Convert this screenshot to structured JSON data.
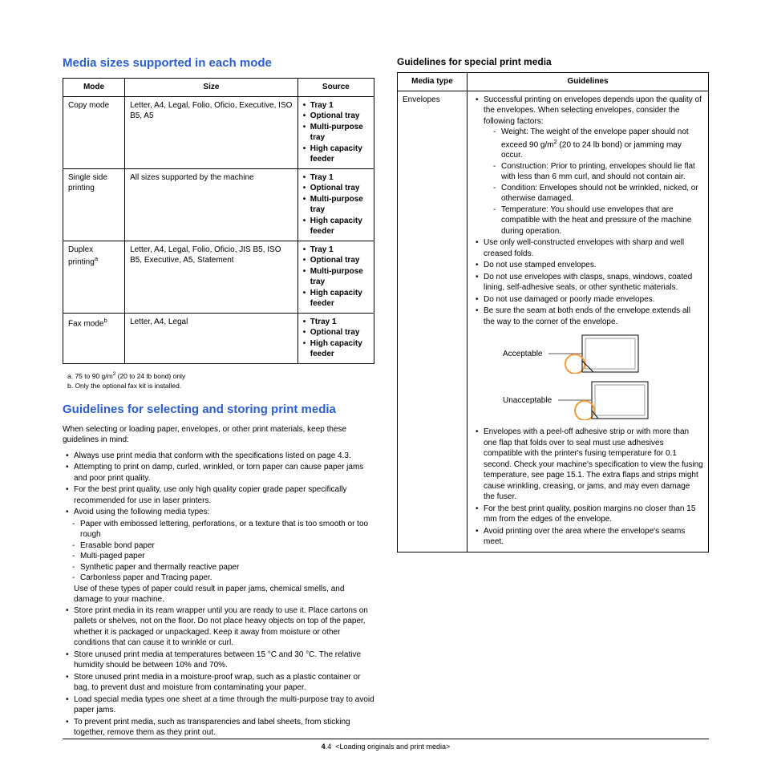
{
  "left": {
    "h2_modes": "Media sizes supported in each mode",
    "modes_table": {
      "head": [
        "Mode",
        "Size",
        "Source"
      ],
      "rows": [
        {
          "mode": "Copy mode",
          "size": "Letter, A4, Legal, Folio, Oficio, Executive, ISO B5, A5",
          "source": [
            "Tray 1",
            "Optional tray",
            "Multi-purpose tray",
            "High capacity feeder"
          ]
        },
        {
          "mode": "Single side printing",
          "size": "All sizes supported by the machine",
          "source": [
            "Tray 1",
            "Optional tray",
            "Multi-purpose tray",
            "High capacity feeder"
          ]
        },
        {
          "mode_html": "Duplex printing<sup>a</sup>",
          "size": "Letter, A4, Legal, Folio, Oficio, JIS B5, ISO B5, Executive, A5, Statement",
          "source": [
            "Tray 1",
            "Optional tray",
            "Multi-purpose tray",
            "High capacity feeder"
          ]
        },
        {
          "mode_html": "Fax mode<sup>b</sup>",
          "size": "Letter, A4, Legal",
          "source": [
            "Ttray 1",
            "Optional tray",
            "High capacity feeder"
          ]
        }
      ]
    },
    "footnote_a": "a. 75 to 90 g/m",
    "footnote_a2": " (20 to 24 lb bond) only",
    "footnote_b": "b. Only the optional fax kit is installed.",
    "h2_guidelines": "Guidelines for selecting and storing print media",
    "intro": "When selecting or loading paper, envelopes, or other print materials, keep these guidelines in mind:",
    "bullets": [
      "Always use print media that conform with the specifications listed on page 4.3.",
      "Attempting to print on damp, curled, wrinkled, or torn paper can cause paper jams and poor print quality.",
      "For the best print quality, use only high quality copier grade paper specifically recommended for use in laser printers.",
      "Avoid using the following media types:"
    ],
    "avoid_sub": [
      "Paper with embossed lettering, perforations, or a texture that is too smooth or too rough",
      "Erasable bond paper",
      "Multi-paged paper",
      "Synthetic paper and thermally reactive paper",
      "Carbonless paper and Tracing paper."
    ],
    "avoid_after": "Use of these types of paper could result in paper jams, chemical smells, and damage to your machine.",
    "bullets2": [
      "Store print media in its ream wrapper until you are ready to use it. Place cartons on pallets or shelves, not on the floor. Do not place heavy objects on top of the paper, whether it is packaged or unpackaged. Keep it away from moisture or other conditions that can cause it to wrinkle or curl.",
      "Store unused print media at temperatures between 15 °C and 30 °C. The relative humidity should be between 10% and 70%.",
      "Store unused print media in a moisture-proof wrap, such as a plastic container or bag, to prevent dust and moisture from contaminating your paper.",
      "Load special media types one sheet at a time through the multi-purpose tray to avoid paper jams.",
      "To prevent print media, such as transparencies and label sheets, from sticking together, remove them as they print out."
    ]
  },
  "right": {
    "h3_special": "Guidelines for special print media",
    "head": [
      "Media type",
      "Guidelines"
    ],
    "media_type": "Envelopes",
    "b1": "Successful printing on envelopes depends upon the quality of the envelopes. When selecting envelopes, consider the following factors:",
    "sub_weight_a": "Weight: The weight of the envelope paper should not exceed 90 g/m",
    "sub_weight_b": " (20 to 24 lb bond) or jamming may occur.",
    "sub_construction": "Construction: Prior to printing, envelopes should lie flat with less than 6 mm curl, and should not contain air.",
    "sub_condition": "Condition: Envelopes should not be wrinkled, nicked, or otherwise damaged.",
    "sub_temperature": "Temperature: You should use envelopes that are compatible with the heat and pressure of the machine during operation.",
    "b2": "Use only well-constructed envelopes with sharp and well creased folds.",
    "b3": "Do not use stamped envelopes.",
    "b4": "Do not use envelopes with clasps, snaps, windows, coated lining, self-adhesive seals, or other synthetic materials.",
    "b5": "Do not use damaged or poorly made envelopes.",
    "b6": "Be sure the seam at both ends of the envelope extends all the way to the corner of the envelope.",
    "acceptable": "Acceptable",
    "unacceptable": "Unacceptable",
    "b7": "Envelopes with a peel-off adhesive strip or with more than one flap that folds over to seal must use adhesives compatible with the printer's fusing temperature for 0.1 second. Check your machine's specification to view the fusing temperature, see page 15.1. The extra flaps and strips might cause wrinkling, creasing, or jams, and may even damage the fuser.",
    "b8": "For the best print quality, position margins no closer than 15 mm from the edges of the envelope.",
    "b9": "Avoid printing over the area where the envelope's seams meet."
  },
  "footer": {
    "num": "4",
    "after": ".4",
    "caption": "<Loading originals and print media>"
  }
}
